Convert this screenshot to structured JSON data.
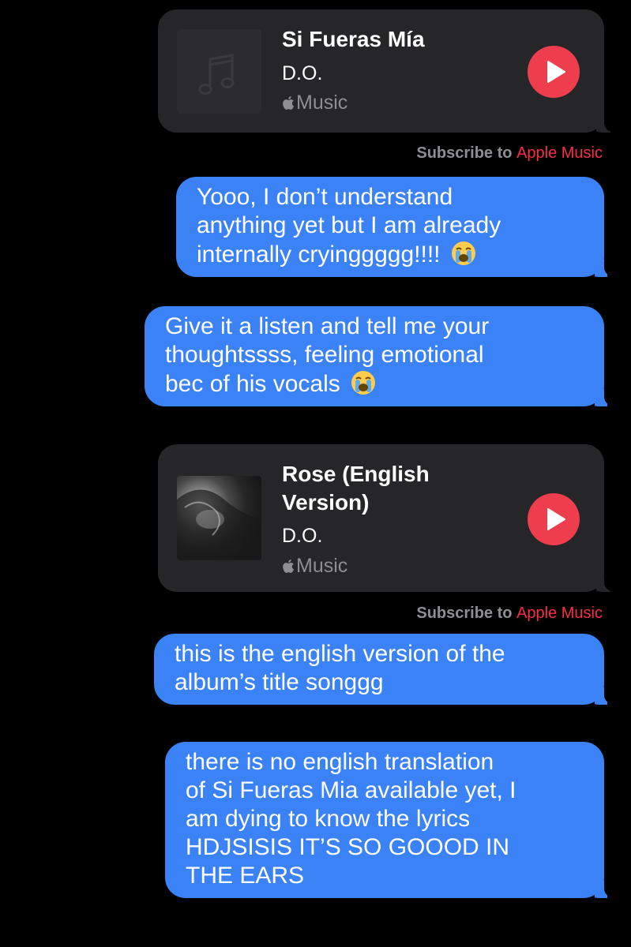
{
  "messages": [
    {
      "type": "music",
      "song_title_lines": [
        "Si Fueras Mía"
      ],
      "artist": "D.O.",
      "service": "Music",
      "artwork": "music-note-placeholder",
      "play_icon": "play-icon"
    },
    {
      "type": "subscribe",
      "prefix": "Subscribe to",
      "link": "Apple Music"
    },
    {
      "type": "text",
      "lines": [
        "Yooo, I don’t understand",
        "anything yet but I am already",
        "internally cryinggggg!!!!"
      ],
      "emoji": "loudly-crying-face"
    },
    {
      "type": "text",
      "lines": [
        "Give it a listen and tell me your",
        "thoughtssss, feeling emotional",
        "bec of his vocals"
      ],
      "emoji": "loudly-crying-face"
    },
    {
      "type": "music",
      "song_title_lines": [
        "Rose (English",
        "Version)"
      ],
      "artist": "D.O.",
      "service": "Music",
      "artwork": "album-photo",
      "play_icon": "play-icon"
    },
    {
      "type": "subscribe",
      "prefix": "Subscribe to",
      "link": "Apple Music"
    },
    {
      "type": "text",
      "lines": [
        "this is the english version of the",
        "album’s title songgg"
      ]
    },
    {
      "type": "text",
      "lines": [
        "there is no english translation",
        "of Si Fueras Mia available yet, I",
        "am dying to know the lyrics",
        "HDJSISIS IT’S SO GOOOD IN",
        "THE EARS"
      ]
    }
  ],
  "colors": {
    "background": "#000000",
    "card": "#262628",
    "bubble_blue": "#3b82f6",
    "play_red": "#ee3e4d",
    "apple_music_red": "#fa2d48",
    "secondary_gray": "#8e8e93"
  }
}
